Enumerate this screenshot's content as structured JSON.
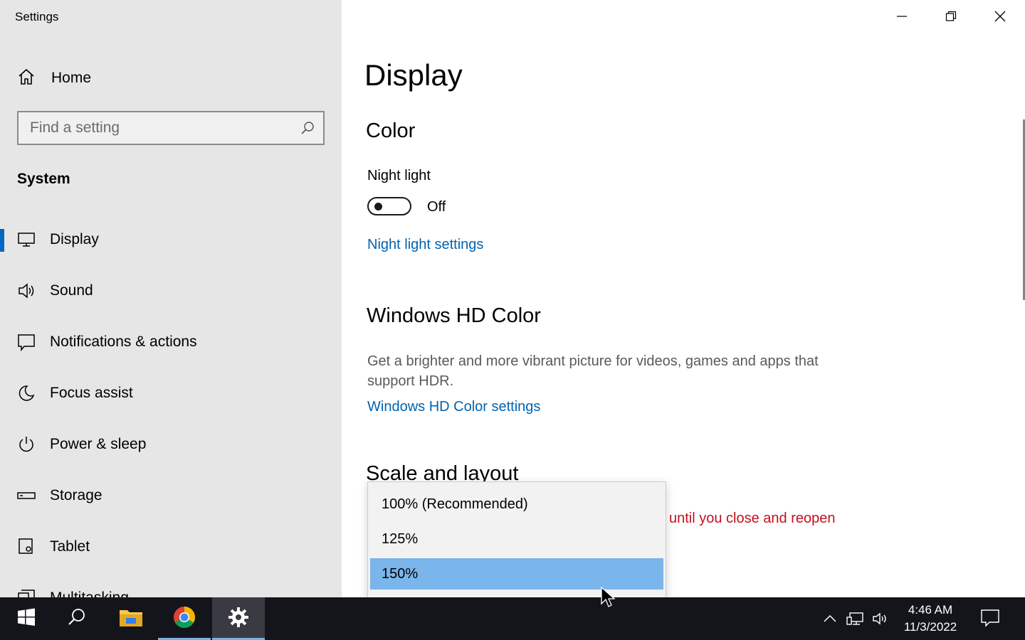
{
  "window": {
    "title": "Settings"
  },
  "sidebar": {
    "home_label": "Home",
    "search_placeholder": "Find a setting",
    "section": "System",
    "items": [
      {
        "label": "Display",
        "icon": "monitor-icon",
        "active": true
      },
      {
        "label": "Sound",
        "icon": "speaker-icon"
      },
      {
        "label": "Notifications & actions",
        "icon": "notification-icon"
      },
      {
        "label": "Focus assist",
        "icon": "moon-icon"
      },
      {
        "label": "Power & sleep",
        "icon": "power-icon"
      },
      {
        "label": "Storage",
        "icon": "storage-icon"
      },
      {
        "label": "Tablet",
        "icon": "tablet-icon"
      },
      {
        "label": "Multitasking",
        "icon": "multitasking-icon"
      }
    ]
  },
  "main": {
    "title": "Display",
    "color_heading": "Color",
    "night_light_label": "Night light",
    "night_light_state": "Off",
    "night_light_link": "Night light settings",
    "hd_heading": "Windows HD Color",
    "hd_desc": "Get a brighter and more vibrant picture for videos, games and apps that support HDR.",
    "hd_link": "Windows HD Color settings",
    "scale_heading": "Scale and layout",
    "warning_partial": "until you close and reopen"
  },
  "dropdown": {
    "options": [
      "100% (Recommended)",
      "125%",
      "150%"
    ],
    "selected": "150%"
  },
  "taskbar": {
    "time": "4:46 AM",
    "date": "11/3/2022"
  },
  "colors": {
    "accent": "#0067c0",
    "link": "#0063b1",
    "warning": "#c50f1f",
    "selected": "#7ab5eb"
  }
}
